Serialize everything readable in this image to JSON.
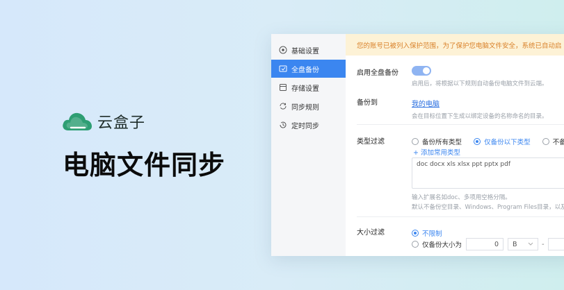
{
  "brand": {
    "name": "云盒子",
    "logo_icon": "cloud-logo-icon",
    "logo_color": "#2e9e73"
  },
  "headline": "电脑文件同步",
  "sidebar": {
    "items": [
      {
        "label": "基础设置",
        "icon": "settings-circle-icon",
        "active": false
      },
      {
        "label": "全盘备份",
        "icon": "backup-icon",
        "active": true
      },
      {
        "label": "存储设置",
        "icon": "storage-icon",
        "active": false
      },
      {
        "label": "同步规则",
        "icon": "sync-icon",
        "active": false
      },
      {
        "label": "定时同步",
        "icon": "clock-sync-icon",
        "active": false
      }
    ]
  },
  "banner": "您的账号已被列入保护范围，为了保护您电脑文件安全，系统已自动启",
  "full_backup": {
    "label": "启用全盘备份",
    "enabled": true,
    "desc": "启用后，将根据以下规则自动备份电脑文件到云端。"
  },
  "backup_to": {
    "label": "备份到",
    "link": "我的电脑",
    "desc": "会在目标位置下生成以绑定设备的名称命名的目录。"
  },
  "type_filter": {
    "label": "类型过滤",
    "options": [
      "备份所有类型",
      "仅备份以下类型",
      "不备份"
    ],
    "selected": 1,
    "add_label": "+ 添加常用类型",
    "extensions": "doc docx xls xlsx ppt pptx pdf",
    "hint1": "输入扩展名如doc、多项用空格分隔。",
    "hint2": "默认不备份空目录、Windows、Program Files目录，以及隐"
  },
  "size_filter": {
    "label": "大小过滤",
    "option_unlimited": "不限制",
    "option_range": "仅备份大小为",
    "min_value": "0",
    "unit": "B",
    "separator": "-"
  },
  "colors": {
    "accent": "#3b86f0",
    "banner_text": "#d9822b",
    "banner_bg": "#fdf2d6"
  }
}
